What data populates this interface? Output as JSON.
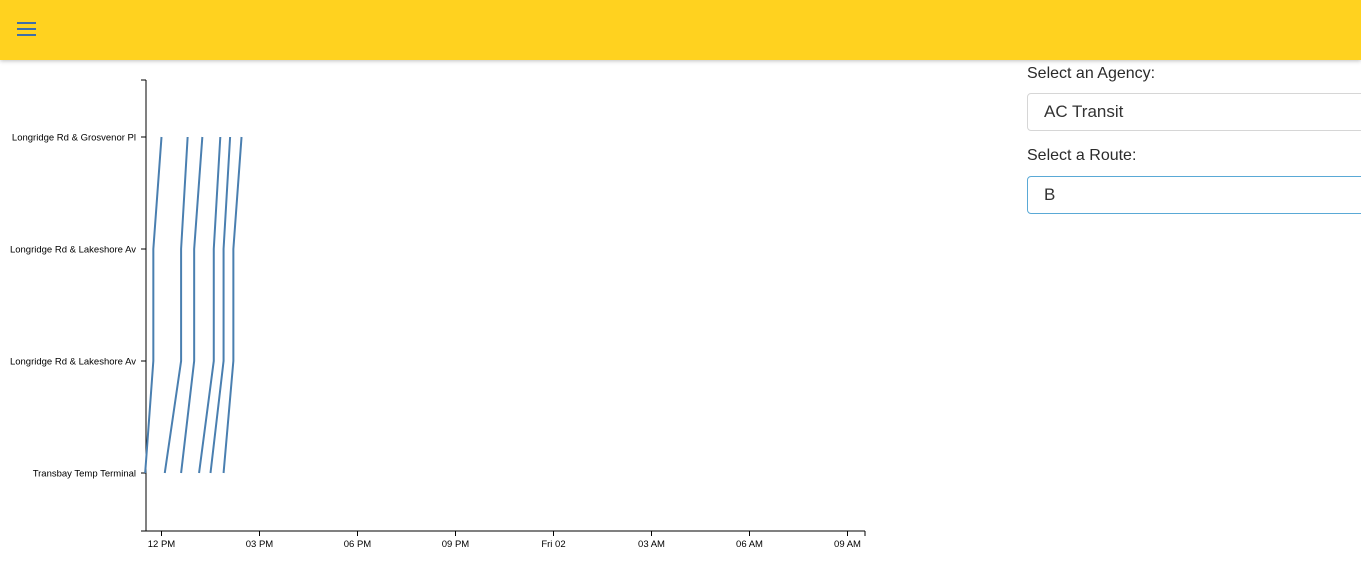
{
  "header": {
    "menu_icon": "hamburger-menu-icon",
    "background_color": "#ffd21f"
  },
  "controls": {
    "agency_label": "Select an Agency:",
    "agency_value": "AC Transit",
    "route_label": "Select a Route:",
    "route_value": "B"
  },
  "chart_data": {
    "type": "line",
    "line_color": "#4a7fb0",
    "x_ticks": [
      "12 PM",
      "03 PM",
      "06 PM",
      "09 PM",
      "Fri 02",
      "03 AM",
      "06 AM",
      "09 AM"
    ],
    "stops": [
      "Transbay Temp Terminal",
      "Longridge Rd & Lakeshore Av",
      "Longridge Rd & Lakeshore Av",
      "Longridge Rd & Grosvenor Pl"
    ],
    "x_unit": "hours from 12 PM",
    "xlim": [
      -0.5,
      21.5
    ],
    "series": [
      {
        "times": [
          -0.5,
          -0.25,
          0.0
        ]
      },
      {
        "times": [
          0.1,
          0.6,
          0.8
        ]
      },
      {
        "times": [
          0.6,
          1.0,
          1.25
        ]
      },
      {
        "times": [
          1.15,
          1.6,
          1.8
        ]
      },
      {
        "times": [
          1.5,
          1.9,
          2.1
        ]
      },
      {
        "times": [
          1.9,
          2.2,
          2.45
        ]
      }
    ]
  }
}
